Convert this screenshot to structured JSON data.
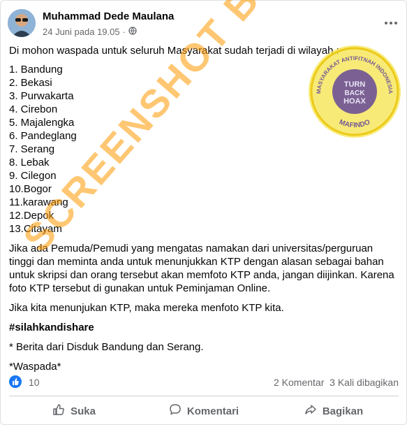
{
  "post": {
    "author": "Muhammad Dede Maulana",
    "date": "24 Juni pada 19.05",
    "separator": "·",
    "intro": "Di mohon waspada untuk seluruh Masyarakat sudah terjadi di wilayah :",
    "list": [
      "1. Bandung",
      "2. Bekasi",
      "3. Purwakarta",
      "4. Cirebon",
      "5. Majalengka",
      "6. Pandeglang",
      "7. Serang",
      "8. Lebak",
      "9. Cilegon",
      "10.Bogor",
      "11.karawang",
      "12.Depok",
      "13.Citayam"
    ],
    "paragraph1": "Jika ada Pemuda/Pemudi yang  mengatas namakan dari universitas/perguruan tinggi dan meminta anda untuk menunjukkan KTP dengan alasan sebagai bahan untuk skripsi dan orang tersebut akan memfoto KTP anda, jangan diijinkan. Karena foto KTP tersebut di gunakan untuk Peminjaman Online.",
    "paragraph2": "Jika kita menunjukan KTP,  maka mereka  menfoto KTP kita.",
    "hashtag": "#silahkandishare",
    "source": "* Berita dari Disduk Bandung dan Serang.",
    "closing": "*Waspada*"
  },
  "stats": {
    "likes": "10",
    "comments": "2 Komentar",
    "shares": "3 Kali dibagikan"
  },
  "actions": {
    "like": "Suka",
    "comment": "Komentari",
    "share": "Bagikan"
  },
  "watermark": {
    "text": "SCREENSHOT BY",
    "stamp_top": "MASYARAKAT ANTIFITNAH INDONESIA",
    "stamp_center": "TURN BACK HOAX",
    "stamp_bottom": "MAFINDO"
  },
  "icons": {
    "privacy": "globe-icon",
    "menu": "more-icon",
    "reaction": "thumbs-up-icon",
    "like": "like-icon",
    "comment": "comment-icon",
    "share": "share-icon"
  },
  "colors": {
    "accent": "#1877f2",
    "watermark": "#ff9900",
    "stamp_ring": "#e8c200",
    "stamp_center": "#5b3f9a"
  }
}
